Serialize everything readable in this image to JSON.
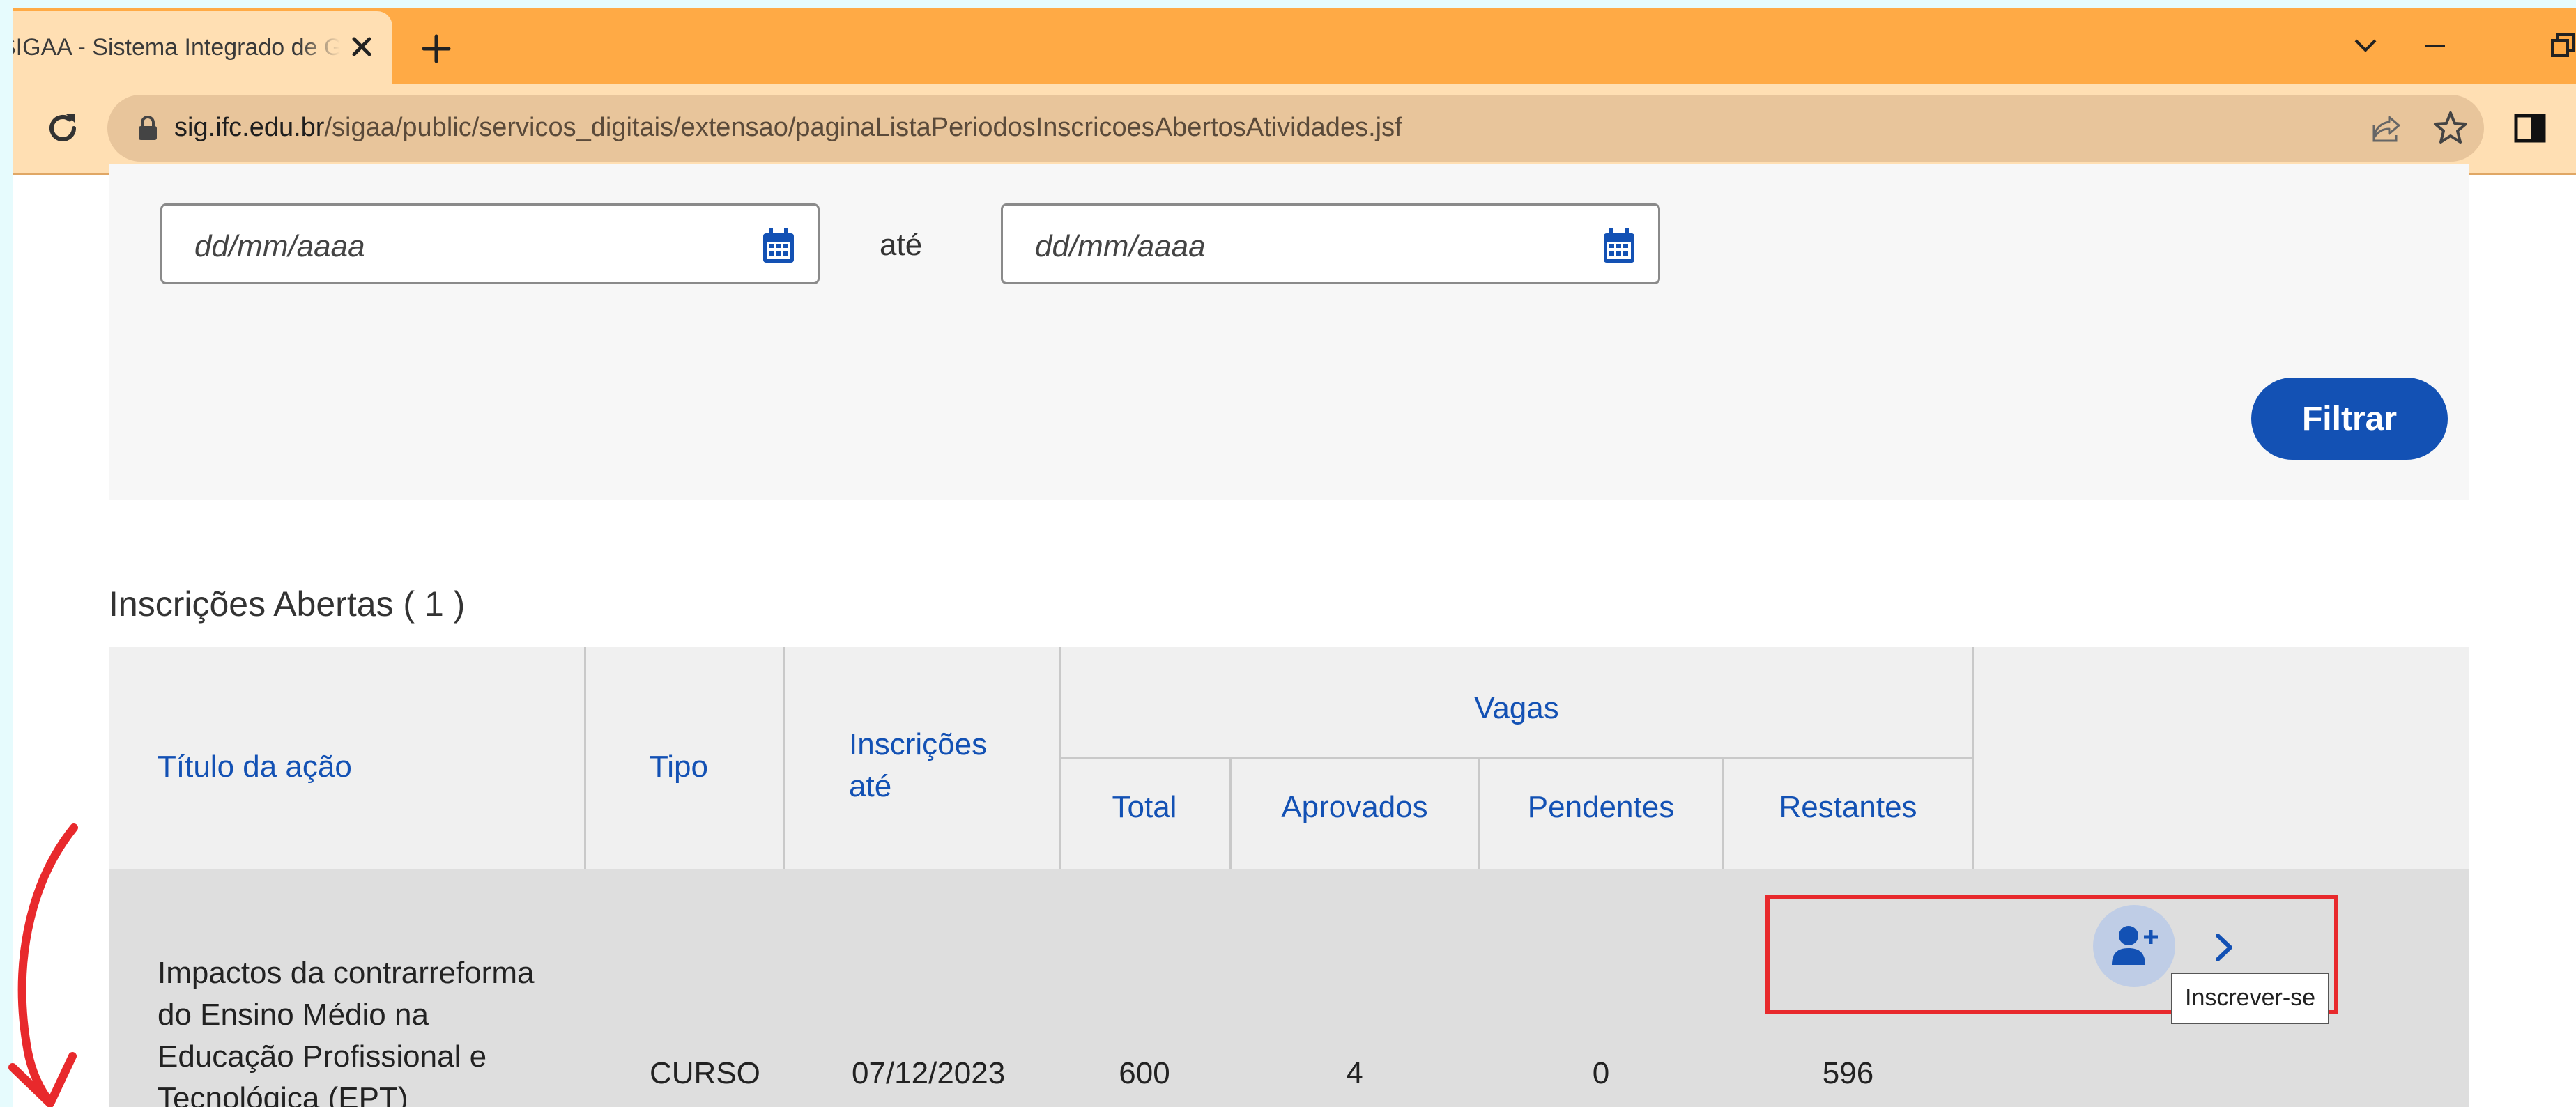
{
  "browser": {
    "tab_title": "SIGAA - Sistema Integrado de Gestão de Atividades Acadêmicas",
    "url_host": "sig.ifc.edu.br",
    "url_path": "/sigaa/public/servicos_digitais/extensao/paginaListaPeriodosInscricoesAbertosAtividades.jsf",
    "icons": [
      "close-icon",
      "plus-icon",
      "chevron-down-icon",
      "minimize-icon",
      "restore-icon",
      "reload-icon",
      "lock-icon",
      "share-icon",
      "star-icon",
      "side-panel-icon"
    ],
    "theme_color": "#ffaa45"
  },
  "filter": {
    "date_from_placeholder": "dd/mm/aaaa",
    "date_to_placeholder": "dd/mm/aaaa",
    "between_label": "até",
    "submit_label": "Filtrar"
  },
  "section": {
    "title": "Inscrições Abertas ( 1 )"
  },
  "table": {
    "headers": {
      "titulo": "Título da ação",
      "tipo": "Tipo",
      "inscricoes_ate": "Inscrições até",
      "vagas": "Vagas",
      "total": "Total",
      "aprovados": "Aprovados",
      "pendentes": "Pendentes",
      "restantes": "Restantes"
    },
    "rows": [
      {
        "titulo": "Impactos da contrarreforma do Ensino Médio na Educação Profissional e Tecnológica (EPT)",
        "tipo": "CURSO",
        "inscricoes_ate": "07/12/2023",
        "total": "600",
        "aprovados": "4",
        "pendentes": "0",
        "restantes": "596"
      }
    ]
  },
  "action": {
    "tooltip": "Inscrever-se",
    "icon": "user-plus-icon"
  },
  "colors": {
    "primary": "#1351b4",
    "highlight": "#e8292c"
  }
}
